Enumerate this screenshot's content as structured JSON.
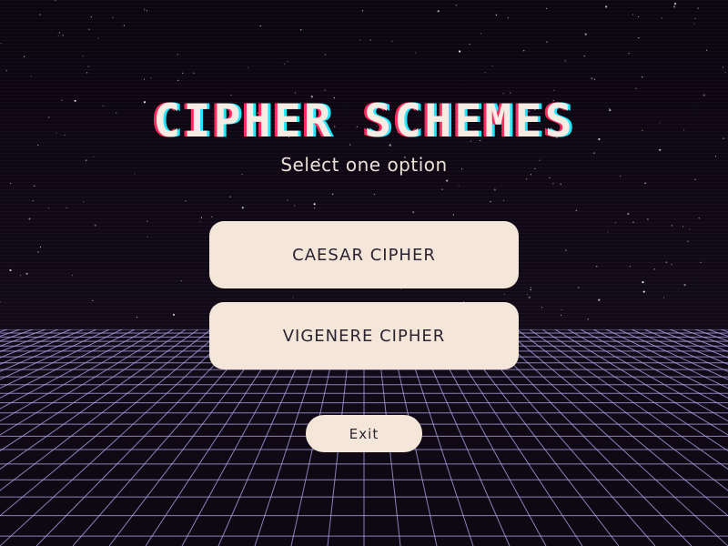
{
  "header": {
    "title": "CIPHER SCHEMES",
    "subtitle": "Select one option"
  },
  "menu": {
    "options": [
      {
        "label": "CAESAR CIPHER"
      },
      {
        "label": "VIGENERE CIPHER"
      }
    ],
    "exit_label": "Exit"
  },
  "colors": {
    "background": "#0c0610",
    "button_fill": "#f5e6da",
    "button_text": "#2a2430",
    "grid_line": "#b4a8f0",
    "title_text": "#f5ece3",
    "title_glitch_red": "#ff2a5f",
    "title_glitch_cyan": "#22e8ff"
  }
}
